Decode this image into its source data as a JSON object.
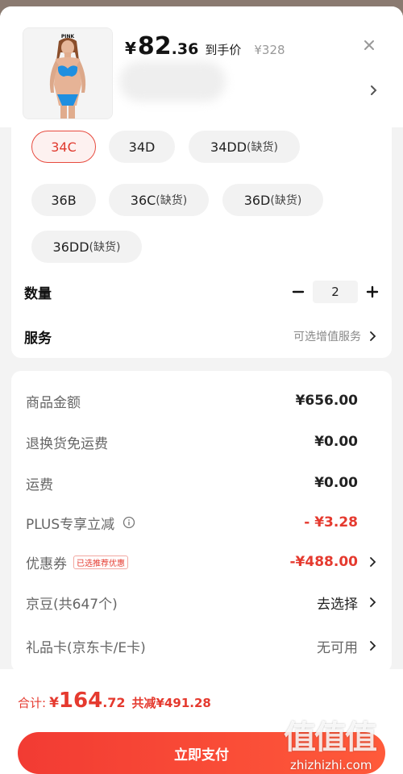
{
  "product": {
    "price_currency": "¥",
    "price_int": "82",
    "price_dec": ".36",
    "price_tag": "到手价",
    "original_price": "¥328",
    "thumb_brand": "PINK"
  },
  "sizes": [
    {
      "label": "34C",
      "sub": "",
      "selected": true
    },
    {
      "label": "34D",
      "sub": "",
      "selected": false
    },
    {
      "label": "34DD",
      "sub": "(缺货)",
      "selected": false
    },
    {
      "label": "36B",
      "sub": "",
      "selected": false
    },
    {
      "label": "36C",
      "sub": "(缺货)",
      "selected": false
    },
    {
      "label": "36D",
      "sub": "(缺货)",
      "selected": false
    },
    {
      "label": "36DD",
      "sub": "(缺货)",
      "selected": false
    }
  ],
  "quantity": {
    "label": "数量",
    "value": "2",
    "minus": "−",
    "plus": "+"
  },
  "service": {
    "label": "服务",
    "value": "可选增值服务"
  },
  "summary": {
    "goods_label": "商品金额",
    "goods_value": "¥656.00",
    "return_label": "退换货免运费",
    "return_value": "¥0.00",
    "shipping_label": "运费",
    "shipping_value": "¥0.00",
    "plus_label": "PLUS专享立减",
    "plus_value": "- ¥3.28",
    "coupon_label": "优惠券",
    "coupon_tag": "已选推荐优惠",
    "coupon_value": "-¥488.00",
    "jd_label": "京豆(共647个)",
    "jd_value": "去选择",
    "gift_label": "礼品卡(京东卡/E卡)",
    "gift_value": "无可用"
  },
  "footer": {
    "total_label": "合计:",
    "total_currency": "¥",
    "total_int": "164",
    "total_dec": ".72",
    "saved": "共减¥491.28",
    "pay_button": "立即支付"
  },
  "watermark": {
    "glyph": "值值值",
    "url": "zhizhizhi.com"
  },
  "colors": {
    "accent": "#e53a2f",
    "button": "#f23b33"
  }
}
